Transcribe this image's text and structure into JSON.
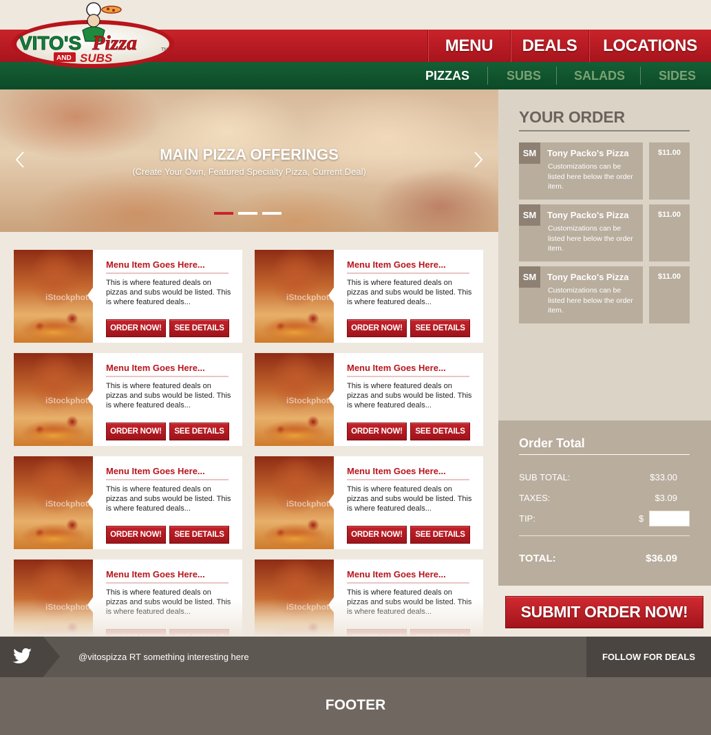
{
  "brand": {
    "logo_text_main": "VITO'S",
    "logo_text_pizza": "Pizza",
    "logo_text_and": "AND",
    "logo_text_subs": "SUBS"
  },
  "main_nav": [
    "MENU",
    "DEALS",
    "LOCATIONS"
  ],
  "sub_nav": {
    "items": [
      "PIZZAS",
      "SUBS",
      "SALADS",
      "SIDES"
    ],
    "active": "PIZZAS"
  },
  "hero": {
    "title": "MAIN PIZZA OFFERINGS",
    "subtitle": "(Create Your Own, Featured Specialty Pizza, Current Deal)",
    "slides_total": 3,
    "active_slide": 1
  },
  "menu_items": [
    {
      "title": "Menu Item Goes Here...",
      "description": "This is where featured deals on pizzas and subs would be listed. This is where featured deals...",
      "order_label": "ORDER NOW!",
      "details_label": "SEE DETAILS",
      "watermark": "iStockphoto"
    },
    {
      "title": "Menu Item Goes Here...",
      "description": "This is where featured deals on pizzas and subs would be listed. This is where featured deals...",
      "order_label": "ORDER NOW!",
      "details_label": "SEE DETAILS",
      "watermark": "iStockphoto"
    },
    {
      "title": "Menu Item Goes Here...",
      "description": "This is where featured deals on pizzas and subs would be listed. This is where featured deals...",
      "order_label": "ORDER NOW!",
      "details_label": "SEE DETAILS",
      "watermark": "iStockphoto"
    },
    {
      "title": "Menu Item Goes Here...",
      "description": "This is where featured deals on pizzas and subs would be listed. This is where featured deals...",
      "order_label": "ORDER NOW!",
      "details_label": "SEE DETAILS",
      "watermark": "iStockphoto"
    },
    {
      "title": "Menu Item Goes Here...",
      "description": "This is where featured deals on pizzas and subs would be listed. This is where featured deals...",
      "order_label": "ORDER NOW!",
      "details_label": "SEE DETAILS",
      "watermark": "iStockphoto"
    },
    {
      "title": "Menu Item Goes Here...",
      "description": "This is where featured deals on pizzas and subs would be listed. This is where featured deals...",
      "order_label": "ORDER NOW!",
      "details_label": "SEE DETAILS",
      "watermark": "iStockphoto"
    },
    {
      "title": "Menu Item Goes Here...",
      "description": "This is where featured deals on pizzas and subs would be listed. This is where featured deals...",
      "order_label": "ORDER NOW!",
      "details_label": "SEE DETAILS",
      "watermark": "iStockphoto"
    },
    {
      "title": "Menu Item Goes Here...",
      "description": "This is where featured deals on pizzas and subs would be listed. This is where featured deals...",
      "order_label": "ORDER NOW!",
      "details_label": "SEE DETAILS",
      "watermark": "iStockphoto"
    }
  ],
  "order": {
    "title": "YOUR ORDER",
    "items": [
      {
        "size": "SM",
        "name": "Tony Packo's Pizza",
        "note": "Customizations can be listed here below the order item.",
        "price": "$11.00"
      },
      {
        "size": "SM",
        "name": "Tony Packo's Pizza",
        "note": "Customizations can be listed here below the order item.",
        "price": "$11.00"
      },
      {
        "size": "SM",
        "name": "Tony Packo's Pizza",
        "note": "Customizations can be listed here below the order item.",
        "price": "$11.00"
      }
    ]
  },
  "totals": {
    "title": "Order Total",
    "subtotal_label": "SUB TOTAL:",
    "subtotal_value": "$33.00",
    "taxes_label": "TAXES:",
    "taxes_value": "$3.09",
    "tip_label": "TIP:",
    "tip_currency": "$",
    "tip_value": "",
    "total_label": "TOTAL:",
    "total_value": "$36.09"
  },
  "submit_label": "SUBMIT ORDER NOW!",
  "twitter": {
    "icon": "twitter-bird-icon",
    "text": "@vitospizza RT something interesting here",
    "follow_label": "FOLLOW FOR DEALS"
  },
  "footer": {
    "text": "FOOTER"
  },
  "colors": {
    "brand_red": "#c9232b",
    "brand_green": "#155f36",
    "background": "#efe8df",
    "sidebar": "#dcd3c7",
    "order_item": "#b9ad9d",
    "footer": "#6f6760"
  }
}
